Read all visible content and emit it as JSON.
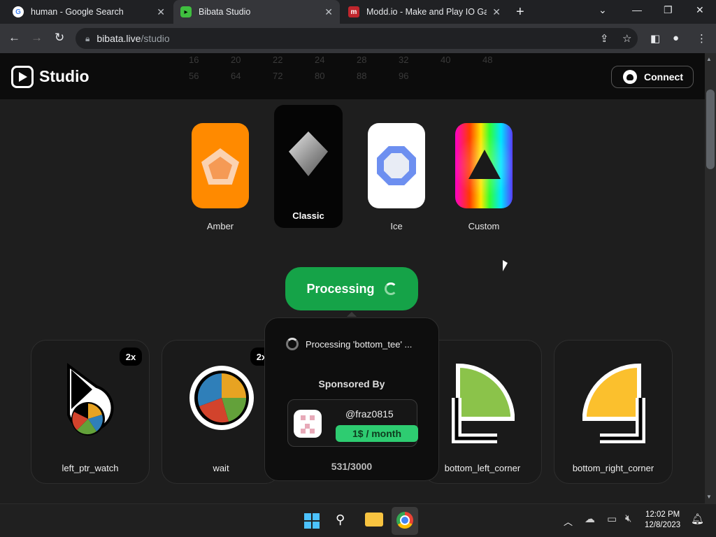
{
  "browser": {
    "tabs": [
      {
        "title": "human - Google Search",
        "favicon": "google-icon"
      },
      {
        "title": "Bibata Studio",
        "favicon": "bibata-icon",
        "active": true
      },
      {
        "title": "Modd.io - Make and Play IO Games",
        "favicon": "modd-icon"
      }
    ],
    "url_host": "bibata.live",
    "url_path": "/studio"
  },
  "header": {
    "brand": "Studio",
    "connect_label": "Connect",
    "ghost_numbers_row1": [
      "16",
      "20",
      "22",
      "24",
      "28",
      "32",
      "40",
      "48"
    ],
    "ghost_numbers_row2": [
      "56",
      "64",
      "72",
      "80",
      "88",
      "96"
    ]
  },
  "themes": [
    {
      "label": "Amber",
      "color": "#ff8a00"
    },
    {
      "label": "Classic",
      "color": "#050505",
      "selected": true
    },
    {
      "label": "Ice",
      "color": "#ffffff"
    },
    {
      "label": "Custom",
      "color": "rainbow"
    }
  ],
  "process_button": {
    "label": "Processing"
  },
  "popover": {
    "status": "Processing 'bottom_tee' ...",
    "sponsored_by": "Sponsored By",
    "sponsor_user": "@fraz0815",
    "sponsor_price": "1$ / month",
    "count": "531/3000"
  },
  "cursors": [
    {
      "name": "left_ptr_watch",
      "badge": "2x"
    },
    {
      "name": "wait",
      "badge": "2x"
    },
    {
      "name": "bottom_left_corner"
    },
    {
      "name": "bottom_right_corner"
    }
  ],
  "taskbar": {
    "time": "12:02 PM",
    "date": "12/8/2023"
  }
}
